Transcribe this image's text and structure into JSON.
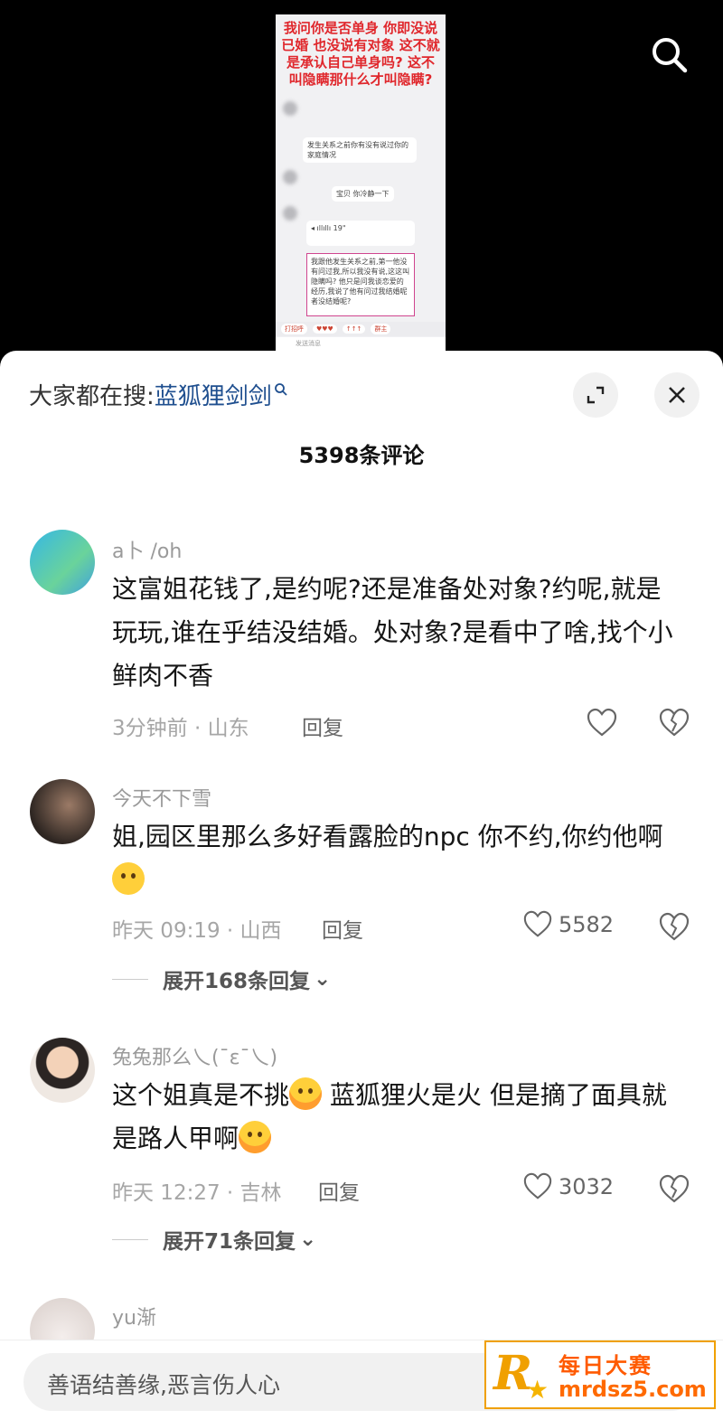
{
  "video": {
    "overlay_text": "我问你是否单身 你即没说已婚 也没说有对象 这不就是承认自己单身吗? 这不叫隐瞒那什么才叫隐瞒?",
    "bubble_1": "发生关系之前你有没有说过你的家庭情况",
    "bubble_2": "宝贝 你冷静一下",
    "voice_duration": "19\"",
    "boxed_text": "我跟他发生关系之前,第一他没有问过我,所以我没有说,这这叫隐瞒吗? 他只是问我谈恋爱的经历,我说了他有问过我结婚呢者没结婚呢?",
    "bar_items": [
      "打招呼",
      "♥♥♥",
      "↑↑↑",
      "群主"
    ],
    "input_placeholder": "发送消息"
  },
  "header": {
    "search_prefix": "大家都在搜:",
    "search_keyword": "蓝狐狸剑剑",
    "comment_count": "5398条评论"
  },
  "comments": [
    {
      "username": "a卜 /oh",
      "text": "这富姐花钱了,是约呢?还是准备处对象?约呢,就是玩玩,谁在乎结没结婚。处对象?是看中了啥,找个小鲜肉不香",
      "time_location": "3分钟前 · 山东",
      "reply_label": "回复",
      "likes": ""
    },
    {
      "username": "今天不下雪",
      "text_part1": "姐,园区里那么多好看露脸的npc 你不约,你约他啊",
      "time_location": "昨天 09:19 · 山西",
      "reply_label": "回复",
      "likes": "5582",
      "expand_label": "展开168条回复"
    },
    {
      "username": "兔兔那么乀(ˉεˉ乀)",
      "text_part1": "这个姐真是不挑",
      "text_part2": " 蓝狐狸火是火 但是摘了面具就是路人甲啊",
      "time_location": "昨天 12:27 · 吉林",
      "reply_label": "回复",
      "likes": "3032",
      "expand_label": "展开71条回复"
    },
    {
      "username": "yu渐"
    }
  ],
  "bottom": {
    "input_placeholder": "善语结善缘,恶言伤人心"
  },
  "watermark": {
    "letter": "R",
    "title": "每日大赛",
    "url": "mrdsz5.com"
  },
  "colors": {
    "keyword": "#1f4f8f",
    "overlay_red": "#e0272c",
    "watermark_orange": "#ff6a00"
  }
}
